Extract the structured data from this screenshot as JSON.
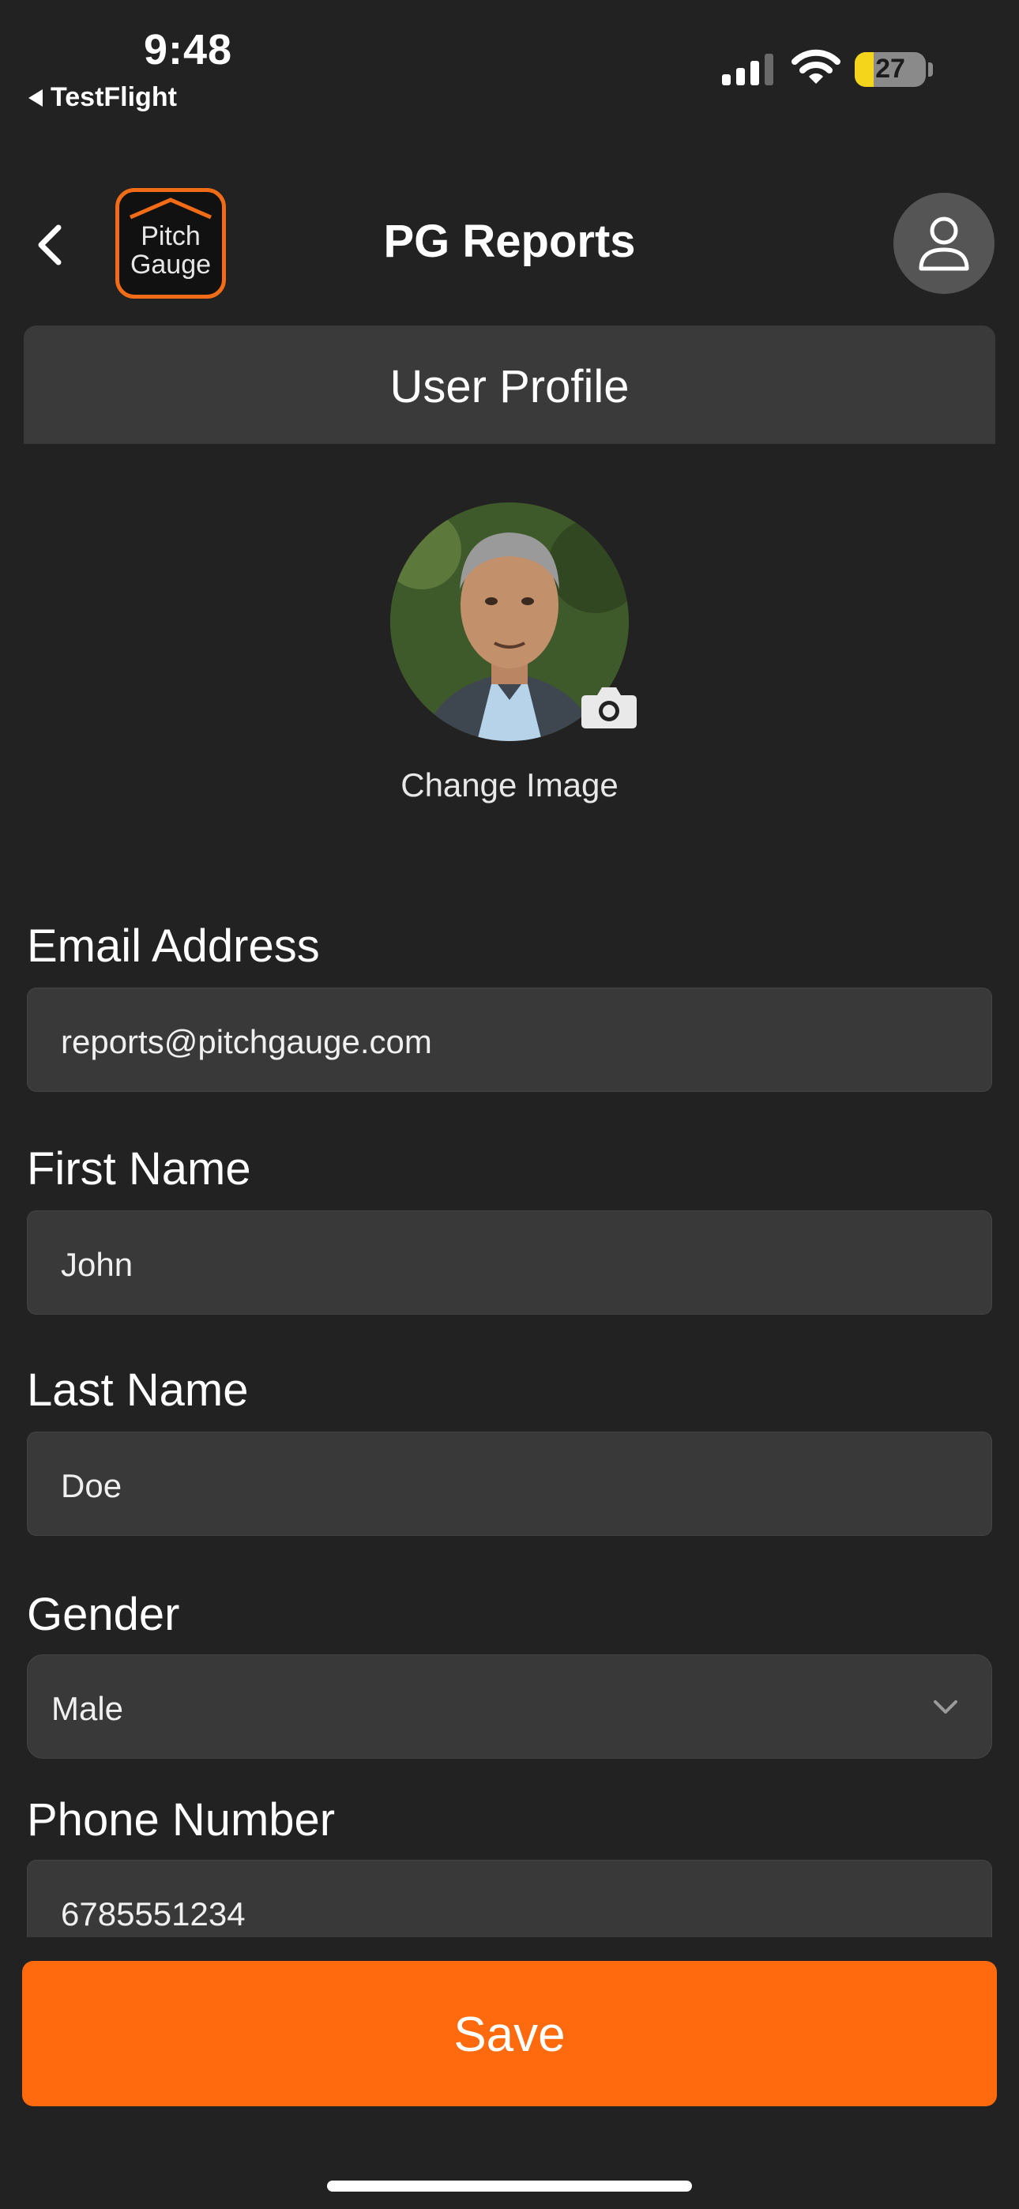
{
  "status_bar": {
    "time": "9:48",
    "back_app": "TestFlight",
    "battery_percent": "27",
    "battery_level": 0.27
  },
  "header": {
    "logo_line1": "Pitch",
    "logo_line2": "Gauge",
    "title": "PG Reports",
    "back_icon": "chevron-left-icon",
    "profile_icon": "person-icon"
  },
  "section": {
    "title": "User Profile"
  },
  "profile": {
    "change_image_label": "Change Image",
    "camera_icon": "camera-icon"
  },
  "form": {
    "email_label": "Email Address",
    "email_value": "reports@pitchgauge.com",
    "first_name_label": "First Name",
    "first_name_value": "John",
    "last_name_label": "Last Name",
    "last_name_value": "Doe",
    "gender_label": "Gender",
    "gender_value": "Male",
    "phone_label": "Phone Number",
    "phone_value": "6785551234"
  },
  "actions": {
    "save_label": "Save"
  },
  "colors": {
    "background": "#222222",
    "accent": "#ff6a0f",
    "field": "#393939",
    "battery_low": "#f5d51b"
  }
}
